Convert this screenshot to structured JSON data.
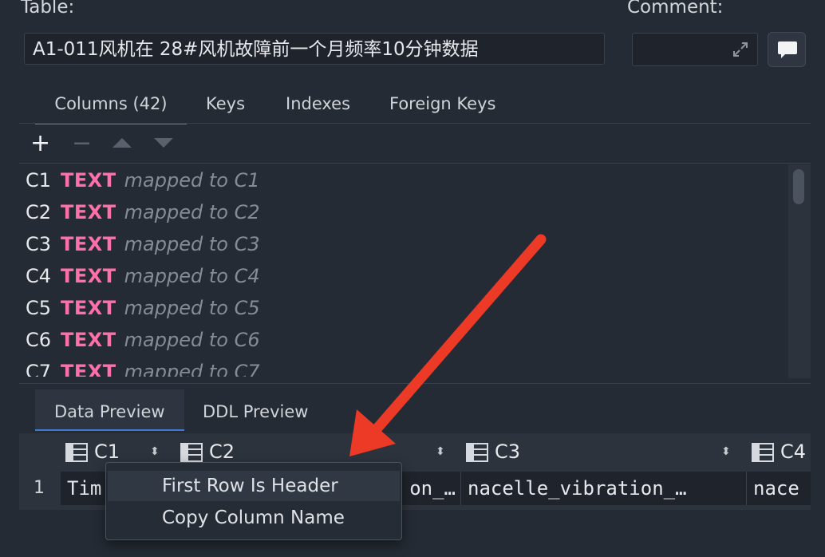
{
  "header": {
    "table_label": "Table:",
    "table_name": "A1-011风机在 28#风机故障前一个月频率10分钟数据",
    "comment_label": "Comment:",
    "comment_value": ""
  },
  "structure_tabs": [
    {
      "label": "Columns (42)",
      "active": true
    },
    {
      "label": "Keys"
    },
    {
      "label": "Indexes"
    },
    {
      "label": "Foreign Keys"
    }
  ],
  "toolbar": {
    "add": "+",
    "remove": "−"
  },
  "columns": [
    {
      "name": "C1",
      "type": "TEXT",
      "mapping": "mapped to C1"
    },
    {
      "name": "C2",
      "type": "TEXT",
      "mapping": "mapped to C2"
    },
    {
      "name": "C3",
      "type": "TEXT",
      "mapping": "mapped to C3"
    },
    {
      "name": "C4",
      "type": "TEXT",
      "mapping": "mapped to C4"
    },
    {
      "name": "C5",
      "type": "TEXT",
      "mapping": "mapped to C5"
    },
    {
      "name": "C6",
      "type": "TEXT",
      "mapping": "mapped to C6"
    },
    {
      "name": "C7",
      "type": "TEXT",
      "mapping": "mapped to C7"
    }
  ],
  "preview_tabs": [
    {
      "label": "Data Preview",
      "active": true
    },
    {
      "label": "DDL Preview"
    }
  ],
  "grid": {
    "headers": [
      "C1",
      "C2",
      "C3",
      "C4"
    ],
    "row_number": "1",
    "row": [
      "Tim",
      "on_…",
      "nacelle_vibration_…",
      "nace"
    ]
  },
  "context_menu": {
    "items": [
      "First Row Is Header",
      "Copy Column Name"
    ]
  },
  "colors": {
    "accent": "#3f7ad3",
    "type_pink": "#ff6fa9",
    "arrow": "#ec3a27"
  }
}
